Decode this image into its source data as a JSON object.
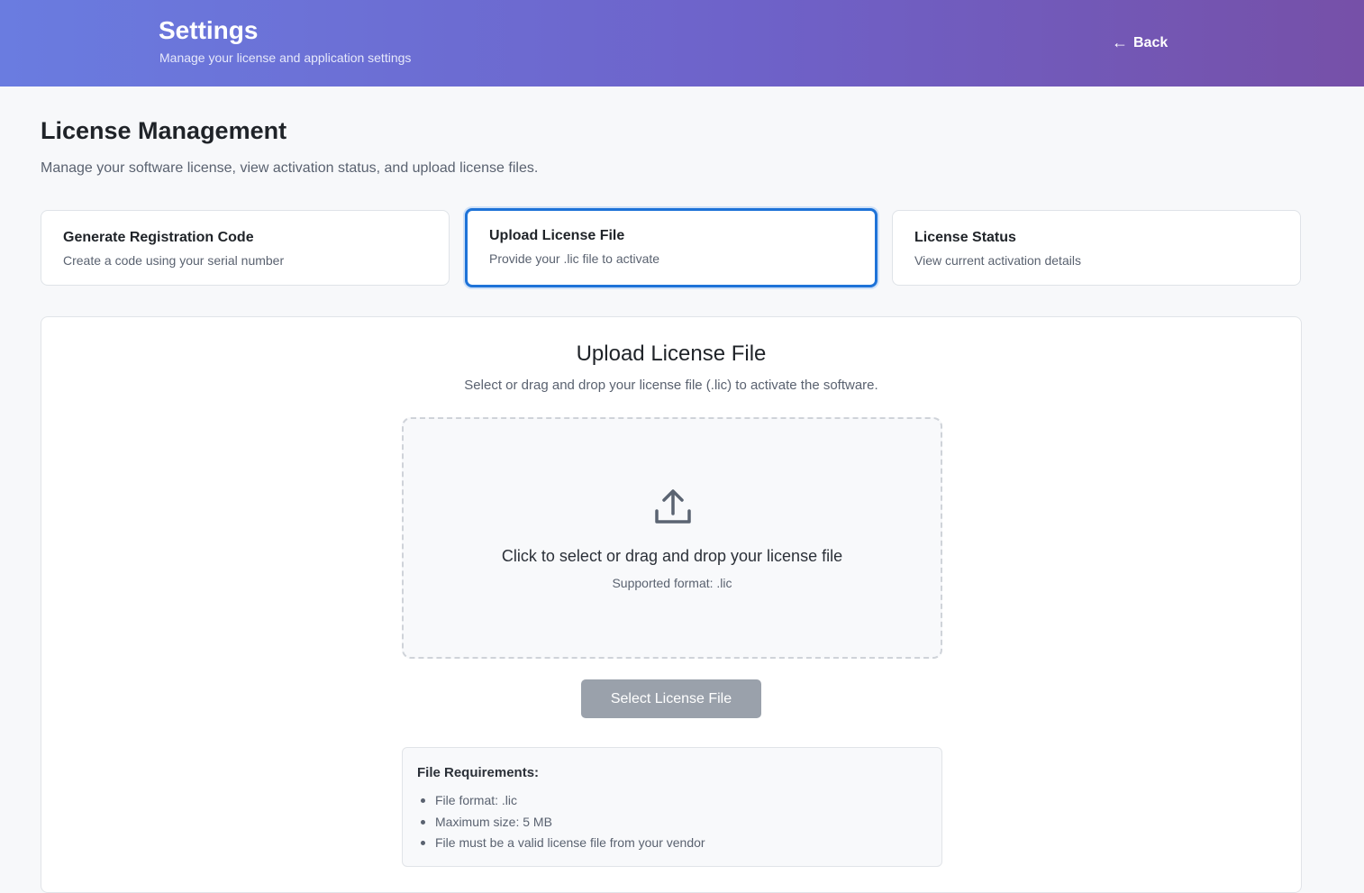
{
  "header": {
    "title": "Settings",
    "subtitle": "Manage your license and application settings",
    "back_label": "Back",
    "back_icon": "←"
  },
  "page": {
    "title": "License Management",
    "description": "Manage your software license, view activation status, and upload license files."
  },
  "tabs": [
    {
      "title": "Generate Registration Code",
      "subtitle": "Create a code using your serial number",
      "active": false
    },
    {
      "title": "Upload License File",
      "subtitle": "Provide your .lic file to activate",
      "active": true
    },
    {
      "title": "License Status",
      "subtitle": "View current activation details",
      "active": false
    }
  ],
  "upload": {
    "title": "Upload License File",
    "description": "Select or drag and drop your license file (.lic) to activate the software.",
    "dropzone_icon": "upload-icon",
    "dropzone_text": "Click to select or drag and drop your license file",
    "dropzone_subtext": "Supported format: .lic",
    "button_label": "Select License File"
  },
  "requirements": {
    "title": "File Requirements:",
    "items": [
      "File format: .lic",
      "Maximum size: 5 MB",
      "File must be a valid license file from your vendor"
    ]
  },
  "colors": {
    "header_gradient_start": "#6a7ce0",
    "header_gradient_end": "#7650a8",
    "active_tab_border": "#1e73d8",
    "disabled_button": "#9aa1ab"
  }
}
